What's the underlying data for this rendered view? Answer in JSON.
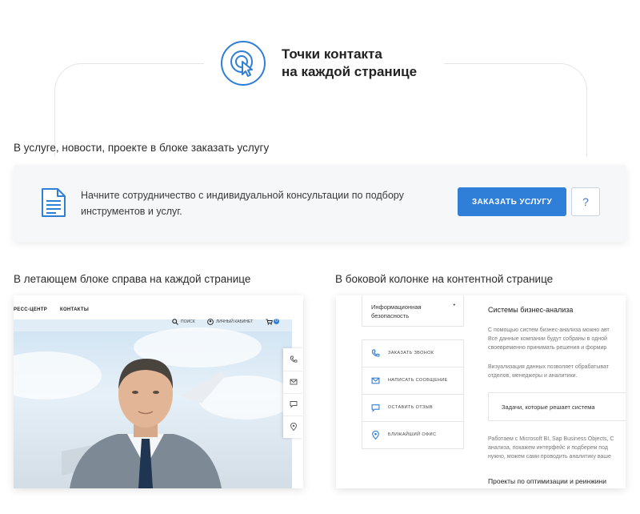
{
  "header": {
    "title_line1": "Точки контакта",
    "title_line2": "на каждой странице",
    "icon": "cursor-click-icon",
    "accent": "#2f7ed8"
  },
  "section_service": {
    "label": "В услуге, новости, проекте в блоке заказать услугу",
    "card_text": "Начните сотрудничество с индивидуальной консультации по подбору инструментов и услуг.",
    "order_button": "ЗАКАЗАТЬ УСЛУГУ",
    "help_button": "?",
    "icon": "document-icon"
  },
  "section_floating": {
    "label": "В летающем блоке справа на каждой странице",
    "nav": {
      "press": "РЕСС-ЦЕНТР",
      "contacts": "КОНТАКТЫ",
      "search": "ПОИСК",
      "cabinet": "ЛИЧНЫЙ КАБИНЕТ",
      "cart_count": "0"
    },
    "side_icons": [
      "phone-icon",
      "mail-icon",
      "chat-icon",
      "location-pin-icon"
    ]
  },
  "section_sidebar": {
    "label": "В боковой колонке на контентной странице",
    "menu_item": "Информационная безопасность",
    "menu_dot": "•",
    "contacts": [
      {
        "label": "ЗАКАЗАТЬ ЗВОНОК",
        "icon": "phone-icon"
      },
      {
        "label": "НАПИСАТЬ СООБЩЕНИЕ",
        "icon": "mail-icon"
      },
      {
        "label": "ОСТАВИТЬ ОТЗЫВ",
        "icon": "chat-icon"
      },
      {
        "label": "БЛИЖАЙШИЙ ОФИС",
        "icon": "location-pin-icon"
      }
    ],
    "content_title": "Системы бизнес-анализа",
    "paragraph1": [
      "С помощью систем бизнес-анализа можно авт",
      "Все данные компании будут собраны в одной",
      "своевременно принимать решения и формир"
    ],
    "paragraph2": [
      "Визуализация данных позволяет обрабатыват",
      "отделов, менеджеры и аналитики."
    ],
    "task_box": "Задачи, которые решает система",
    "paragraph3": [
      "Работаем с Microsoft BI, Sap Business Objects, С",
      "анализа, покажем интерфейс и подберем под",
      "нужно, можем сами проводить аналитику ваше"
    ],
    "content_subtitle": "Проекты по оптимизации и реинжини"
  }
}
